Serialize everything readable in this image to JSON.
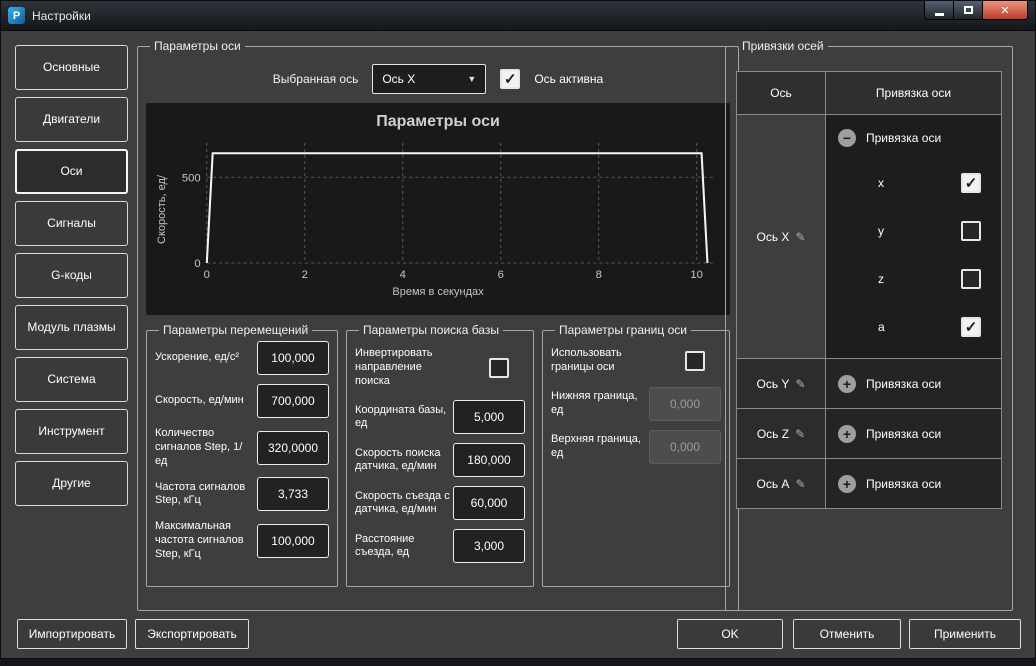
{
  "window": {
    "title": "Настройки",
    "app_icon": "P"
  },
  "sidebar": {
    "items": [
      {
        "label": "Основные"
      },
      {
        "label": "Двигатели"
      },
      {
        "label": "Оси"
      },
      {
        "label": "Сигналы"
      },
      {
        "label": "G-коды"
      },
      {
        "label": "Модуль плазмы"
      },
      {
        "label": "Система"
      },
      {
        "label": "Инструмент"
      },
      {
        "label": "Другие"
      }
    ]
  },
  "axis_params": {
    "group_title": "Параметры оси",
    "selected_axis_label": "Выбранная ось",
    "selected_axis_value": "Ось X",
    "axis_active_label": "Ось активна",
    "axis_active_checked": true
  },
  "chart_data": {
    "type": "line",
    "title": "Параметры оси",
    "xlabel": "Время в секундах",
    "ylabel": "Скорость, ед/",
    "x_ticks": [
      0,
      2,
      4,
      6,
      8,
      10
    ],
    "y_ticks": [
      0,
      500
    ],
    "xlim": [
      0,
      10.35
    ],
    "ylim": [
      0,
      700
    ],
    "grid": true,
    "line_color": "#f5f5f5",
    "x": [
      0,
      0.12,
      10.1,
      10.22
    ],
    "y": [
      0,
      640,
      640,
      0
    ]
  },
  "movement_params": {
    "group_title": "Параметры перемещений",
    "fields": [
      {
        "label": "Ускорение, ед/с²",
        "value": "100,000"
      },
      {
        "label": "Скорость, ед/мин",
        "value": "700,000"
      },
      {
        "label": "Количество сигналов Step, 1/ед",
        "value": "320,0000"
      },
      {
        "label": "Частота сигналов Step, кГц",
        "value": "3,733"
      },
      {
        "label": "Максимальная частота сигналов Step, кГц",
        "value": "100,000"
      }
    ]
  },
  "homing_params": {
    "group_title": "Параметры поиска базы",
    "invert_label": "Инвертировать направление поиска",
    "invert_checked": false,
    "fields": [
      {
        "label": "Координата базы, ед",
        "value": "5,000"
      },
      {
        "label": "Скорость поиска датчика, ед/мин",
        "value": "180,000"
      },
      {
        "label": "Скорость съезда с датчика, ед/мин",
        "value": "60,000"
      },
      {
        "label": "Расстояние съезда, ед",
        "value": "3,000"
      }
    ]
  },
  "limit_params": {
    "group_title": "Параметры границ оси",
    "use_limits_label": "Использовать границы оси",
    "use_limits_checked": false,
    "fields": [
      {
        "label": "Нижняя граница, ед",
        "value": "0,000"
      },
      {
        "label": "Верхняя граница, ед",
        "value": "0,000"
      }
    ]
  },
  "bindings": {
    "group_title": "Привязки осей",
    "col_axis": "Ось",
    "col_binding": "Привязка оси",
    "expanded": {
      "axis": "Ось X",
      "toggle_label": "Привязка оси",
      "checkboxes": [
        {
          "label": "x",
          "checked": true
        },
        {
          "label": "y",
          "checked": false
        },
        {
          "label": "z",
          "checked": false
        },
        {
          "label": "a",
          "checked": true
        }
      ]
    },
    "collapsed": [
      {
        "axis": "Ось Y",
        "toggle_label": "Привязка оси"
      },
      {
        "axis": "Ось Z",
        "toggle_label": "Привязка оси"
      },
      {
        "axis": "Ось A",
        "toggle_label": "Привязка оси"
      }
    ]
  },
  "footer": {
    "import": "Импортировать",
    "export": "Экспортировать",
    "ok": "OK",
    "cancel": "Отменить",
    "apply": "Применить"
  }
}
